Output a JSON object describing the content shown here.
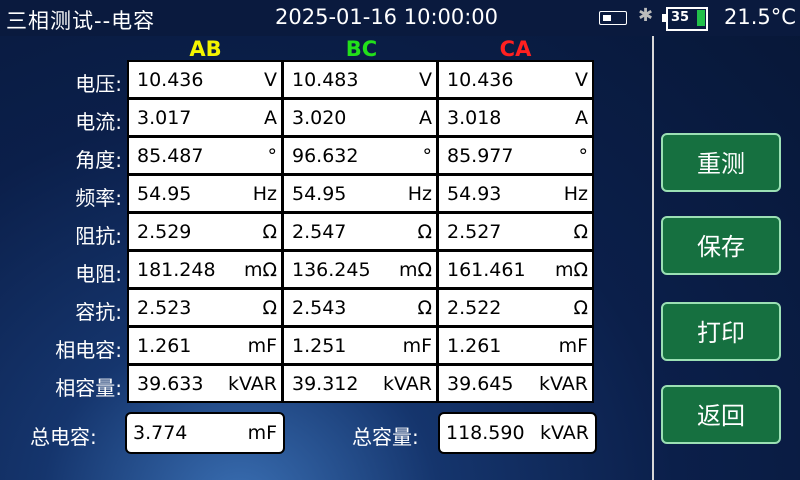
{
  "header": {
    "title": "三相测试--电容",
    "datetime": "2025-01-16 10:00:00",
    "battery": "35",
    "temperature": "21.5°C",
    "icons": [
      "usb-icon",
      "bluetooth-icon",
      "battery-icon"
    ]
  },
  "columns": [
    "AB",
    "BC",
    "CA"
  ],
  "rows": [
    {
      "label": "电压:",
      "cells": [
        [
          "10.436",
          "V"
        ],
        [
          "10.483",
          "V"
        ],
        [
          "10.436",
          "V"
        ]
      ]
    },
    {
      "label": "电流:",
      "cells": [
        [
          "3.017",
          "A"
        ],
        [
          "3.020",
          "A"
        ],
        [
          "3.018",
          "A"
        ]
      ]
    },
    {
      "label": "角度:",
      "cells": [
        [
          "85.487",
          "°"
        ],
        [
          "96.632",
          "°"
        ],
        [
          "85.977",
          "°"
        ]
      ]
    },
    {
      "label": "频率:",
      "cells": [
        [
          "54.95",
          "Hz"
        ],
        [
          "54.95",
          "Hz"
        ],
        [
          "54.93",
          "Hz"
        ]
      ]
    },
    {
      "label": "阻抗:",
      "cells": [
        [
          "2.529",
          "Ω"
        ],
        [
          "2.547",
          "Ω"
        ],
        [
          "2.527",
          "Ω"
        ]
      ]
    },
    {
      "label": "电阻:",
      "cells": [
        [
          "181.248",
          "mΩ"
        ],
        [
          "136.245",
          "mΩ"
        ],
        [
          "161.461",
          "mΩ"
        ]
      ]
    },
    {
      "label": "容抗:",
      "cells": [
        [
          "2.523",
          "Ω"
        ],
        [
          "2.543",
          "Ω"
        ],
        [
          "2.522",
          "Ω"
        ]
      ]
    },
    {
      "label": "相电容:",
      "cells": [
        [
          "1.261",
          "mF"
        ],
        [
          "1.251",
          "mF"
        ],
        [
          "1.261",
          "mF"
        ]
      ]
    },
    {
      "label": "相容量:",
      "cells": [
        [
          "39.633",
          "kVAR"
        ],
        [
          "39.312",
          "kVAR"
        ],
        [
          "39.645",
          "kVAR"
        ]
      ]
    }
  ],
  "totals": {
    "capacitance_label": "总电容:",
    "capacitance_value": "3.774",
    "capacitance_unit": "mF",
    "capacity_label": "总容量:",
    "capacity_value": "118.590",
    "capacity_unit": "kVAR"
  },
  "buttons": {
    "remeasure": "重测",
    "save": "保存",
    "print": "打印",
    "back": "返回"
  },
  "colors": {
    "ab": "#f4f400",
    "bc": "#22e01a",
    "ca": "#ff2020",
    "button_bg": "#167040"
  }
}
